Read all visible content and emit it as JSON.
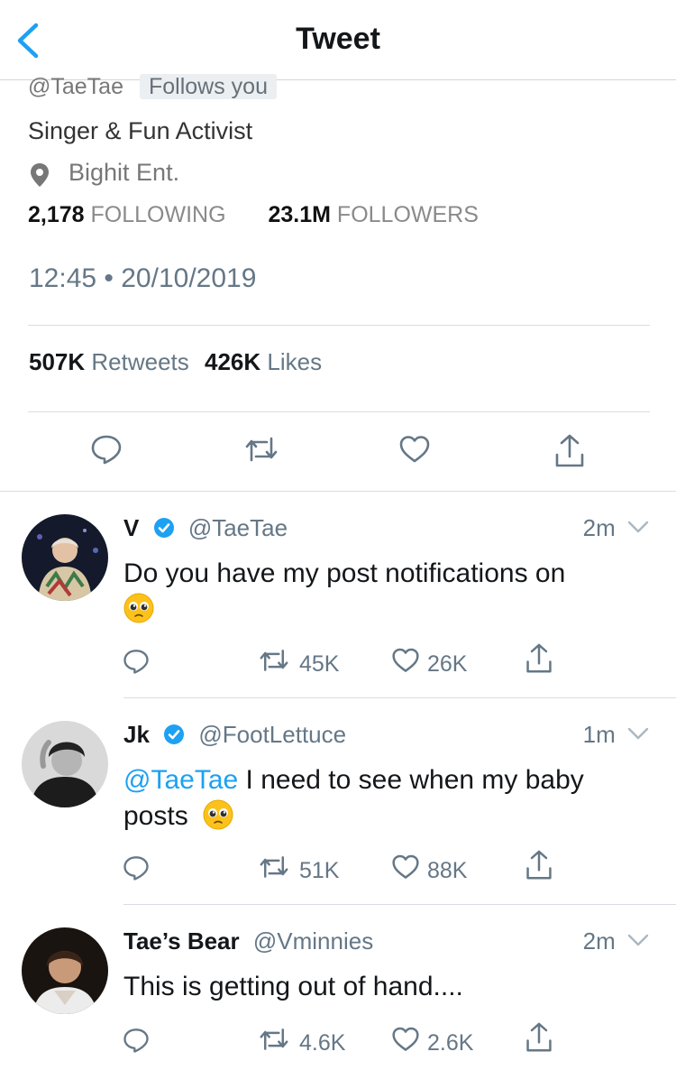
{
  "header": {
    "title": "Tweet"
  },
  "profile": {
    "handle": "@TaeTae",
    "follows_badge": "Follows you",
    "bio": "Singer & Fun Activist",
    "location": "Bighit Ent.",
    "following_count": "2,178",
    "following_label": "FOLLOWING",
    "followers_count": "23.1M",
    "followers_label": "FOLLOWERS"
  },
  "tweet": {
    "timestamp": "12:45 • 20/10/2019",
    "retweets_count": "507K",
    "retweets_label": "Retweets",
    "likes_count": "426K",
    "likes_label": "Likes"
  },
  "replies": [
    {
      "name": "V",
      "verified": true,
      "handle": "@TaeTae",
      "time": "2m",
      "text_line1": "Do you have my post notifications on",
      "retweets": "45K",
      "likes": "26K"
    },
    {
      "name": "Jk",
      "verified": true,
      "handle": "@FootLettuce",
      "time": "1m",
      "mention": "@TaeTae",
      "text_line1": " I need to see when my baby",
      "text_line2": "posts",
      "retweets": "51K",
      "likes": "88K"
    },
    {
      "name": "Tae’s Bear",
      "verified": false,
      "handle": "@Vminnies",
      "time": "2m",
      "text_line1": "This is getting out of hand....",
      "retweets": "4.6K",
      "likes": "2.6K"
    }
  ],
  "colors": {
    "accent": "#1da1f2",
    "text": "#14171a",
    "muted": "#657786",
    "divider": "#d8dde1"
  }
}
